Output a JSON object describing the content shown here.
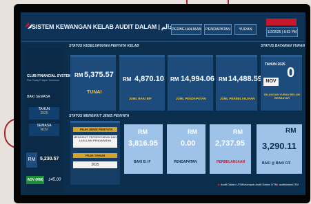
{
  "header": {
    "title": "SISTEM KEWANGAN KELAB AUDIT DALAM | كلب اوديت دالم",
    "nav": [
      "PERBELANJAAN",
      "PENDAPATAN",
      "YURAN"
    ],
    "datetime": "1/2/2025 | 8:52 PM"
  },
  "sections": {
    "status_kewangan": "STATUS KESELURUHAN PENYATA KELAB",
    "status_yuran": "STATUS BAYARAN YURAN",
    "status_bulanan": "STATUS MENGIKUT JENIS PENYATA"
  },
  "sidebar": {
    "club_name": "CLUB FINANCIAL SYSTEM",
    "club_tagline": "Plan Today Prosper Tomorrow",
    "section": "BAKI SEMASA",
    "tahun_label": "TAHUN",
    "tahun_value": "2025",
    "semasa_label": "SEMASA",
    "semasa_value": "NOV",
    "rm_label": "RM",
    "rm_value": "5,230.57",
    "adv_label": "ADV (RM)",
    "adv_value": "145.00"
  },
  "cards": [
    {
      "rm": "RM",
      "value": "5,375.57",
      "label": "TUNAI"
    },
    {
      "rm": "RM",
      "value": "4,870.10",
      "label": "JUML BAKI B/F"
    },
    {
      "rm": "RM",
      "value": "14,994.06",
      "label": "JUML PENDAPATAN"
    },
    {
      "rm": "RM",
      "value": "14,488.59",
      "label": "JUML PERBELANJAAN"
    }
  ],
  "yuran": {
    "tahun_label": "TAHUN 2025",
    "count": "0",
    "month": "NOV",
    "caption": "BILANGAN YURAN BELUM BERBAYAR"
  },
  "filters": {
    "jenis_label": "PILIH JENIS PENYATA",
    "jenis_value": "MENGIKUT PERSEKITARAN DAN LAIN-LAIN PENDAPATAN",
    "tahun_label": "PILIH TAHUN",
    "tahun_value": "2025"
  },
  "summary": [
    {
      "rm": "RM",
      "value": "3,816.95",
      "label": "BAKI B / F"
    },
    {
      "rm": "RM",
      "value": "0.00",
      "label": "PENDAPATAN"
    },
    {
      "rm": "RM",
      "value": "2,737.95",
      "label": "PERBELANJAAN"
    },
    {
      "rm": "RM",
      "value": "3,290.11",
      "label": "BAKI @ BAKI C/F"
    }
  ],
  "footer": [
    "Audit Dalam UTM",
    "Kelompok Audit Dalam UTM",
    "auditdalamUTM"
  ]
}
